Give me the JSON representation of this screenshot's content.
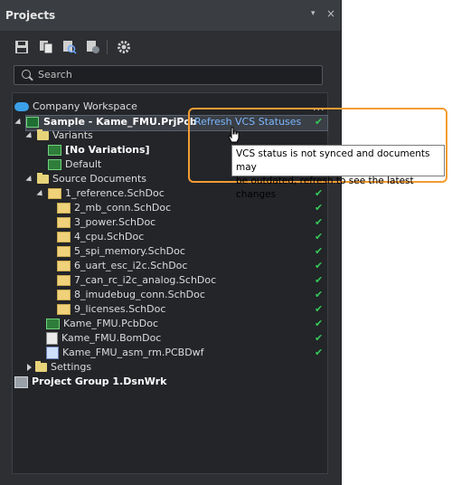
{
  "panel": {
    "title": "Projects",
    "controls": {
      "pin": "▾",
      "close": "×"
    },
    "toolbar": [
      {
        "name": "save-icon"
      },
      {
        "name": "copy-icon"
      },
      {
        "name": "search-files-icon"
      },
      {
        "name": "vcs-icon"
      },
      {
        "name": "gear-icon"
      }
    ],
    "search": {
      "placeholder": "Search"
    }
  },
  "tree": {
    "workspace": "Company Workspace",
    "more": "...",
    "project": "Sample - Kame_FMU.PrjPcb",
    "refresh_label": "Refresh VCS Statuses",
    "variants": "Variants",
    "no_variations": "[No Variations]",
    "default": "Default",
    "source_docs": "Source Documents",
    "schdocs": [
      "1_reference.SchDoc",
      "2_mb_conn.SchDoc",
      "3_power.SchDoc",
      "4_cpu.SchDoc",
      "5_spi_memory.SchDoc",
      "6_uart_esc_i2c.SchDoc",
      "7_can_rc_i2c_analog.SchDoc",
      "8_imudebug_conn.SchDoc",
      "9_licenses.SchDoc"
    ],
    "pcbdoc": "Kame_FMU.PcbDoc",
    "bomdoc": "Kame_FMU.BomDoc",
    "pcbdwf": "Kame_FMU_asm_rm.PCBDwf",
    "settings": "Settings",
    "group": "Project Group 1.DsnWrk"
  },
  "tooltip": {
    "line1": "VCS status is not synced and documents may",
    "line2": "be outdated, refresh to see the latest changes"
  },
  "colors": {
    "accent_orange": "#f39c33",
    "check_green": "#37c75a",
    "link_blue": "#7ab7ff"
  }
}
